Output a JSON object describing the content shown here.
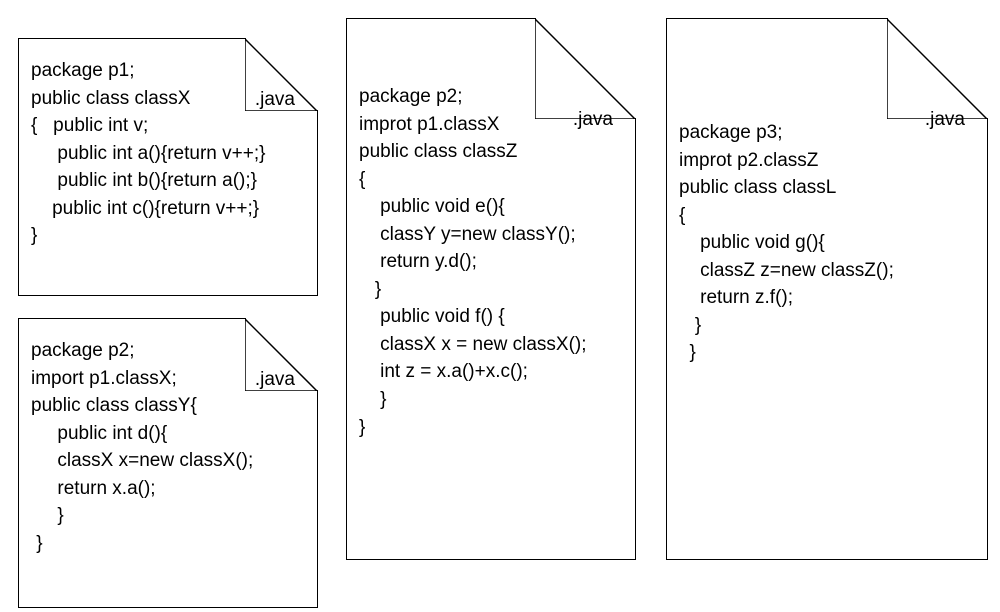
{
  "files": [
    {
      "ext": ".java",
      "code": "package p1;\npublic class classX\n{   public int v;\n     public int a(){return v++;}\n     public int b(){return a();}\n    public int c(){return v++;}\n}"
    },
    {
      "ext": ".java",
      "code": "package p2;\nimport p1.classX;\npublic class classY{\n     public int d(){\n     classX x=new classX();\n     return x.a();\n     }\n }"
    },
    {
      "ext": ".java",
      "code": "package p2;\nimprot p1.classX\npublic class classZ\n{\n    public void e(){\n    classY y=new classY();\n    return y.d();\n   }\n    public void f() {\n    classX x = new classX();\n    int z = x.a()+x.c();\n    }\n}"
    },
    {
      "ext": ".java",
      "code": "package p3;\nimprot p2.classZ\npublic class classL\n{\n    public void g(){\n    classZ z=new classZ();\n    return z.f();\n   }\n  }"
    }
  ]
}
